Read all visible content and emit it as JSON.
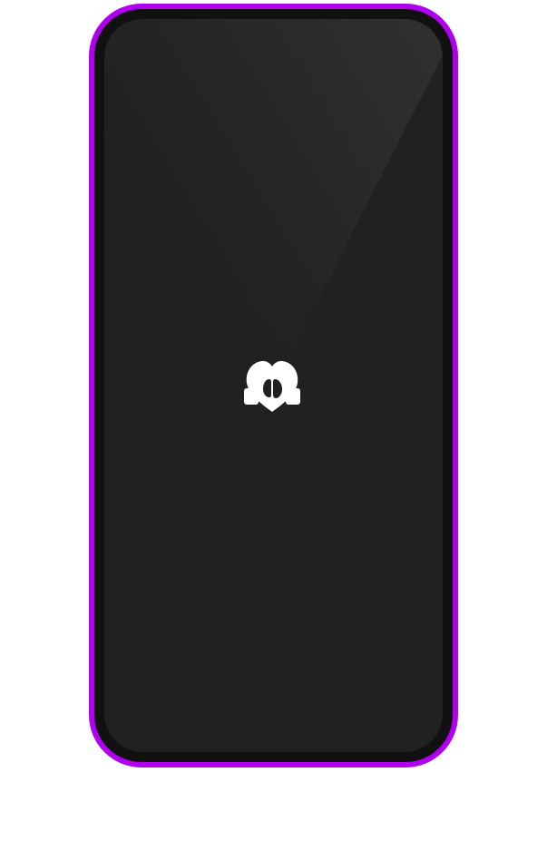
{
  "device": {
    "frame_color": "#b000ef",
    "bezel_color": "#111111",
    "screen_color": "#212121"
  },
  "screen": {
    "state": "splash",
    "logo": {
      "icon": "heart-logo-icon",
      "color": "#ffffff"
    }
  }
}
